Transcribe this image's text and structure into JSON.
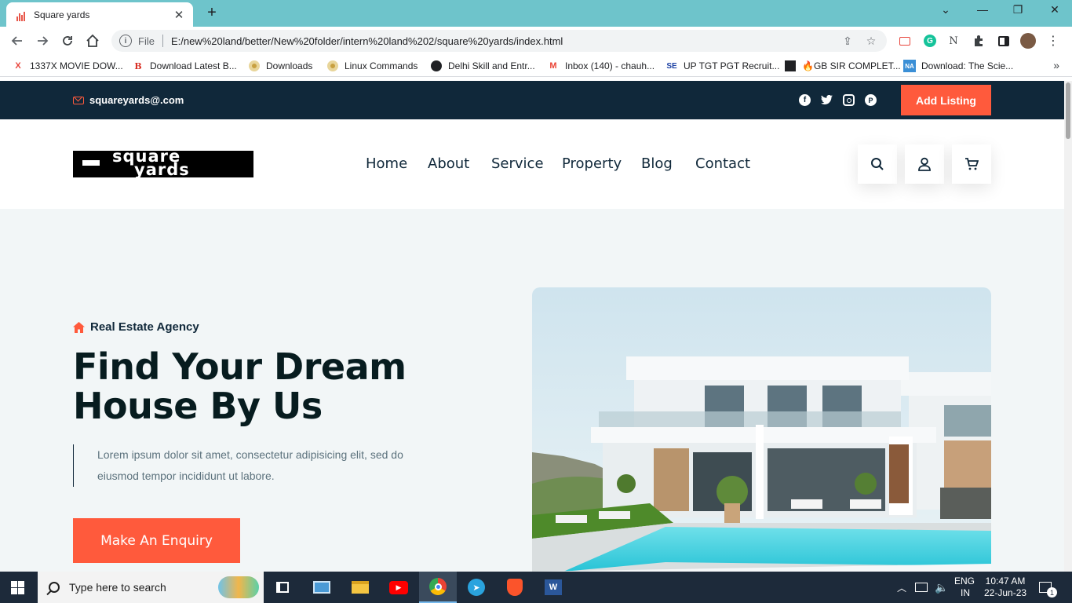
{
  "browser": {
    "tab_title": "Square yards",
    "url_scheme_label": "File",
    "url": "E:/new%20land/better/New%20folder/intern%20land%202/square%20yards/index.html",
    "bookmarks": [
      {
        "label": "1337X MOVIE DOW...",
        "icon": "x-icon",
        "color": "#e8453c"
      },
      {
        "label": "Download Latest B...",
        "icon": "b-icon",
        "color": "#d93025"
      },
      {
        "label": "Downloads",
        "icon": "disc-icon",
        "color": "#c8a040"
      },
      {
        "label": "Linux Commands",
        "icon": "disc-icon",
        "color": "#c8a040"
      },
      {
        "label": "Delhi Skill and Entr...",
        "icon": "globe-icon",
        "color": "#202124"
      },
      {
        "label": "Inbox (140) - chauh...",
        "icon": "gmail-icon",
        "color": "#ea4335"
      },
      {
        "label": "UP TGT PGT Recruit...",
        "icon": "se-icon",
        "color": "#1a3fa3"
      },
      {
        "label": "🔥GB SIR COMPLET...",
        "icon": "film-icon",
        "color": "#202124"
      },
      {
        "label": "Download: The Scie...",
        "icon": "na-icon",
        "color": "#3b8fd6"
      }
    ]
  },
  "site": {
    "topbar": {
      "email": "squareyards@.com",
      "add_listing": "Add Listing",
      "socials": [
        "facebook-icon",
        "twitter-icon",
        "instagram-icon",
        "pinterest-icon"
      ]
    },
    "logo": {
      "line1": "square",
      "line2": "yards"
    },
    "nav": [
      "Home",
      "About",
      "Service",
      "Property",
      "Blog",
      "Contact"
    ],
    "hero": {
      "tagline": "Real Estate Agency",
      "title": "Find Your Dream House By Us",
      "description": "Lorem ipsum dolor sit amet, consectetur adipisicing elit, sed do eiusmod tempor incididunt ut labore.",
      "cta": "Make An Enquiry"
    },
    "accent": "#ff5a3c",
    "dark": "#10283a"
  },
  "taskbar": {
    "search_placeholder": "Type here to search",
    "lang_top": "ENG",
    "lang_bottom": "IN",
    "time": "10:47 AM",
    "date": "22-Jun-23",
    "notification_count": "1"
  }
}
